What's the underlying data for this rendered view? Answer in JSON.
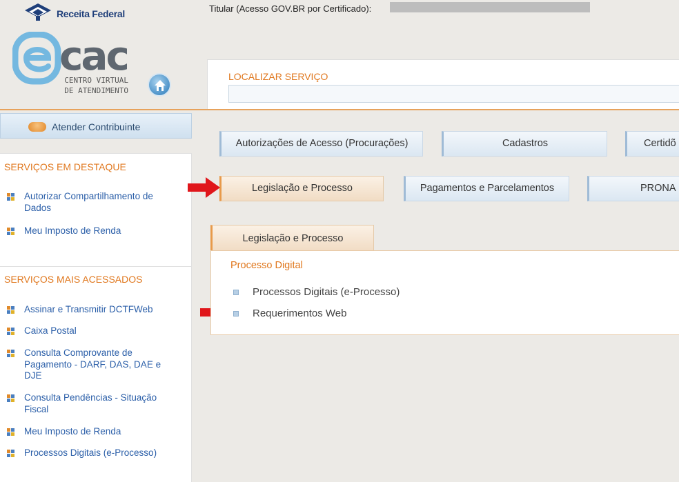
{
  "header": {
    "brand": "Receita Federal",
    "titular_label": "Titular (Acesso GOV.BR por Certificado):",
    "logo_word": "cac",
    "logo_subtitle_line1": "CENTRO VIRTUAL",
    "logo_subtitle_line2": "DE ATENDIMENTO"
  },
  "search": {
    "label": "LOCALIZAR SERVIÇO",
    "value": ""
  },
  "sidebar": {
    "atender_button": "Atender Contribuinte",
    "destaque": {
      "title": "SERVIÇOS EM DESTAQUE",
      "items": [
        "Autorizar Compartilhamento de Dados",
        "Meu Imposto de Renda"
      ]
    },
    "mais_acessados": {
      "title": "SERVIÇOS MAIS ACESSADOS",
      "items": [
        "Assinar e Transmitir DCTFWeb",
        "Caixa Postal",
        "Consulta Comprovante de Pagamento - DARF, DAS, DAE e DJE",
        "Consulta Pendências - Situação Fiscal",
        "Meu Imposto de Renda",
        "Processos Digitais (e-Processo)"
      ]
    }
  },
  "categories": {
    "row1": [
      "Autorizações de Acesso (Procurações)",
      "Cadastros",
      "Certidõ"
    ],
    "row2": [
      "Legislação e Processo",
      "Pagamentos e Parcelamentos",
      "PRONA"
    ]
  },
  "tab_panel": {
    "tab_label": "Legislação e Processo",
    "heading": "Processo Digital",
    "items": [
      "Processos Digitais (e-Processo)",
      "Requerimentos Web"
    ]
  },
  "colors": {
    "accent_orange": "#e0771d",
    "link_blue": "#2a5ea8",
    "annotation_arrow": "#e0161b"
  }
}
